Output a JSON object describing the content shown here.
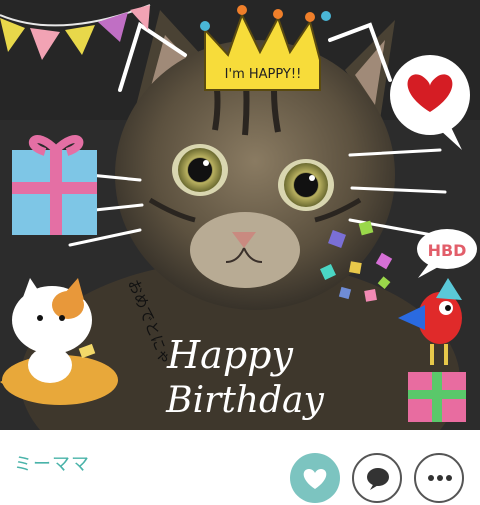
{
  "post": {
    "photo_text": {
      "crown": "I'm HAPPY!!",
      "side_message": "おめでとにゃ",
      "bubble": "HBD",
      "happy": "Happy",
      "birthday": "Birthday"
    }
  },
  "author": {
    "name": "ミーママ"
  },
  "actions": {
    "like_icon": "heart-icon",
    "comment_icon": "speech-bubble-icon",
    "more_icon": "ellipsis-icon",
    "like_color": "#7cc4c0"
  }
}
